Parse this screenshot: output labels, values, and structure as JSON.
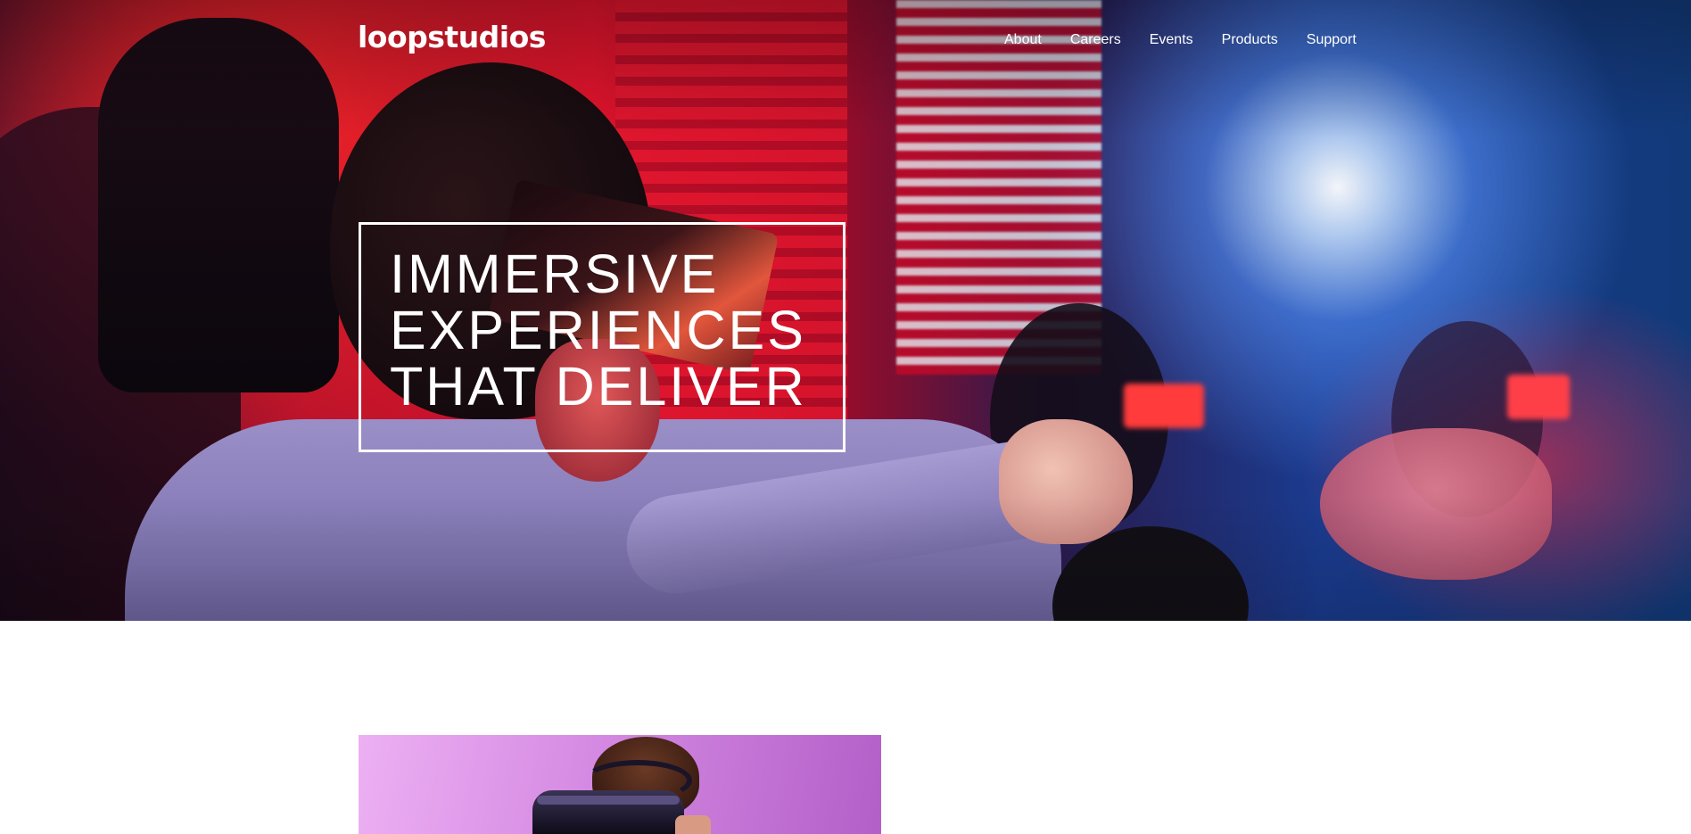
{
  "header": {
    "logo": "loopstudios",
    "nav": [
      {
        "label": "About"
      },
      {
        "label": "Careers"
      },
      {
        "label": "Events"
      },
      {
        "label": "Products"
      },
      {
        "label": "Support"
      }
    ]
  },
  "hero": {
    "headline_lines": [
      "IMMERSIVE",
      "EXPERIENCES",
      "THAT DELIVER"
    ]
  },
  "colors": {
    "text_on_hero": "#ffffff",
    "page_background": "#ffffff"
  }
}
